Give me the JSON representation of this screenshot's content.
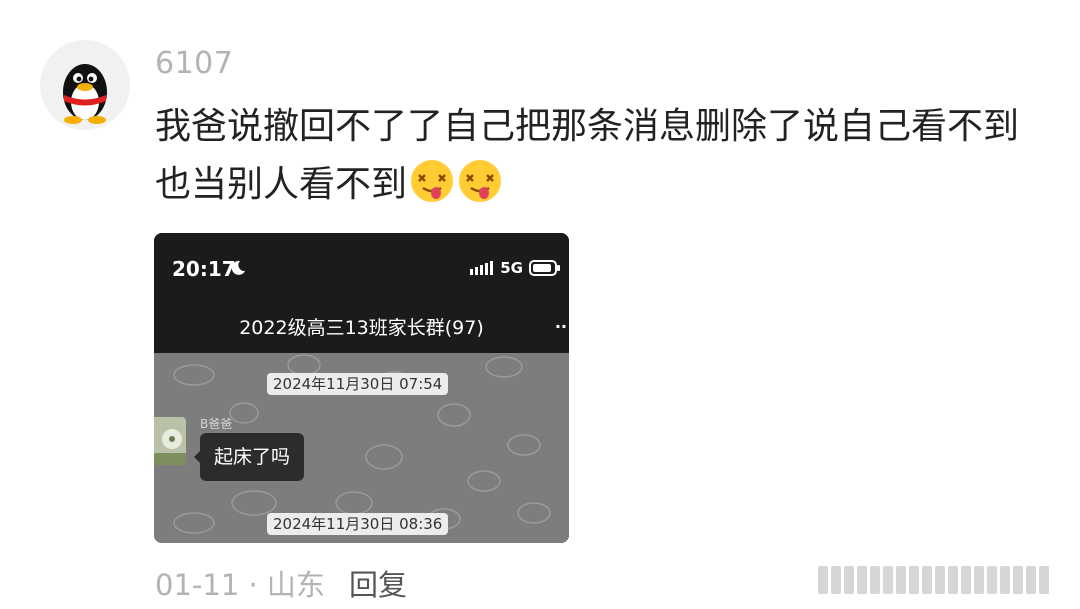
{
  "comment": {
    "username": "6107",
    "text": "我爸说撤回不了了自己把那条消息删除了说自己看不到也当别人看不到",
    "emojis": [
      "drooling-face-emoji",
      "drooling-face-emoji"
    ],
    "location_meta": "01-11 · 山东",
    "reply_label": "回复"
  },
  "screenshot": {
    "status_time": "20:17",
    "network": "5G",
    "group_title": "2022级高三13班家长群(97)",
    "dates": [
      "2024年11月30日 07:54",
      "2024年11月30日 08:36"
    ],
    "message": {
      "sender": "B爸爸",
      "text": "起床了吗"
    }
  },
  "colors": {
    "username": "#b3b3b3",
    "comment_text": "#222222",
    "screenshot_header": "#1b1b1b",
    "chat_background": "#7d7d7d",
    "bubble": "#2c2c2c"
  }
}
